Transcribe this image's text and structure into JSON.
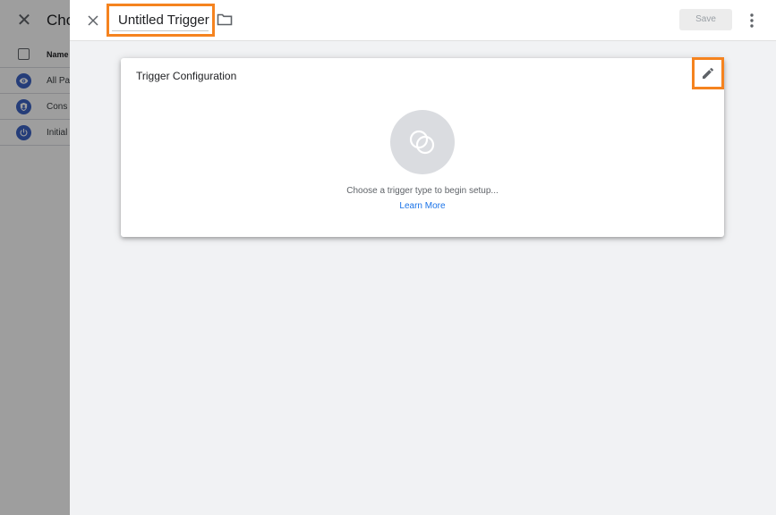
{
  "background_panel": {
    "close_icon": "close-icon",
    "title": "Cho",
    "table_header": "Name",
    "rows": [
      {
        "label": "All Pa",
        "icon": "eye-icon"
      },
      {
        "label": "Cons",
        "icon": "shield-icon"
      },
      {
        "label": "Initial",
        "icon": "power-icon"
      }
    ],
    "icon_color": "#3c63c4"
  },
  "sheet": {
    "close_icon": "close-icon",
    "trigger_name": "Untitled Trigger",
    "folder_icon": "folder-icon",
    "save_label": "Save",
    "more_icon": "more-vert-icon",
    "highlight_color": "#f5831f"
  },
  "trigger_config": {
    "title": "Trigger Configuration",
    "edit_icon": "pencil-icon",
    "placeholder_icon": "trigger-type-icon",
    "choose_text": "Choose a trigger type to begin setup...",
    "learn_more": "Learn More",
    "link_color": "#1a73e8"
  }
}
